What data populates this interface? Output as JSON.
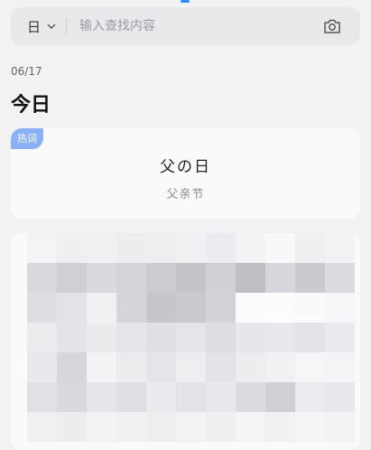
{
  "search": {
    "language": "日",
    "placeholder": "输入查找内容"
  },
  "date": "06/17",
  "section_title": "今日",
  "hot_card": {
    "badge": "热词",
    "title": "父の日",
    "subtitle": "父亲节"
  },
  "colors": {
    "accent": "#2f8cff",
    "badge": "#8ab0f5",
    "page_bg": "#f2f2f4",
    "card_bg": "#fafafb"
  },
  "icons": {
    "dropdown": "chevron-down-icon",
    "camera": "camera-icon"
  }
}
